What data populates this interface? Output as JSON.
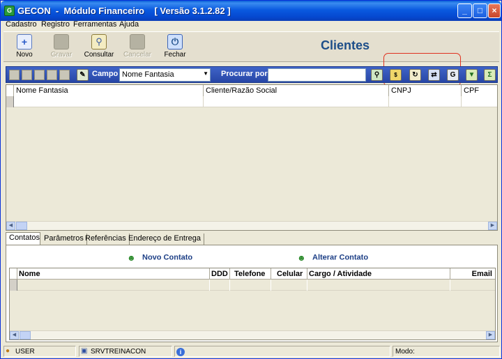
{
  "window": {
    "title": "GECON  -  Módulo Financeiro    [ Versão 3.1.2.82 ]",
    "app_icon": "G"
  },
  "menu": [
    {
      "label": "Cadastro",
      "accel": "C"
    },
    {
      "label": "Registro",
      "accel": "R"
    },
    {
      "label": "Ferramentas",
      "accel": "F"
    },
    {
      "label": "Ajuda",
      "accel": "A"
    }
  ],
  "toolbar": {
    "novo": "Novo",
    "gravar": "Gravar",
    "consultar": "Consultar",
    "cancelar": "Cancelar",
    "fechar": "Fechar"
  },
  "page_heading": "Clientes",
  "search": {
    "campo_label": "Campo",
    "campo_value": "Nome Fantasia",
    "procurar_label": "Procurar por",
    "procurar_value": ""
  },
  "grid": {
    "columns": [
      "Nome Fantasia",
      "Cliente/Razão Social",
      "CNPJ",
      "CPF"
    ]
  },
  "tabs": [
    "Contatos",
    "Parâmetros",
    "Referências",
    "Endereço de Entrega"
  ],
  "contacts": {
    "new_label": "Novo Contato",
    "edit_label": "Alterar Contato",
    "columns": [
      "Nome",
      "DDD",
      "Telefone",
      "Celular",
      "Cargo / Atividade",
      "Email"
    ]
  },
  "status": {
    "user": "USER",
    "server": "SRVTREINACON",
    "info_icon": "i",
    "mode_label": "Modo:"
  },
  "colors": {
    "heading": "#1d4e89",
    "highlight_box": "#e0311f",
    "searchbar": "#2f52b8"
  }
}
